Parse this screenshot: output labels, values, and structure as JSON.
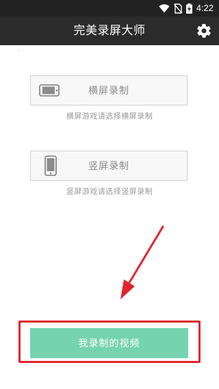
{
  "status_bar": {
    "time": "4:22",
    "icons": [
      "wifi-icon",
      "no-sim-icon",
      "battery-charging-icon"
    ]
  },
  "header": {
    "title": "完美录屏大师",
    "settings_icon": "gear-icon"
  },
  "options": [
    {
      "label": "横屏录制",
      "description": "横屏游戏请选择横屏录制",
      "icon": "phone-landscape-icon"
    },
    {
      "label": "竖屏录制",
      "description": "竖屏游戏请选择竖屏录制",
      "icon": "phone-portrait-icon"
    }
  ],
  "bottom_button": {
    "label": "我录制的视频"
  },
  "colors": {
    "header_bg": "#2b2b2b",
    "button_bg": "#76d3b0",
    "highlight": "#e0252f",
    "arrow": "#e0252f"
  }
}
